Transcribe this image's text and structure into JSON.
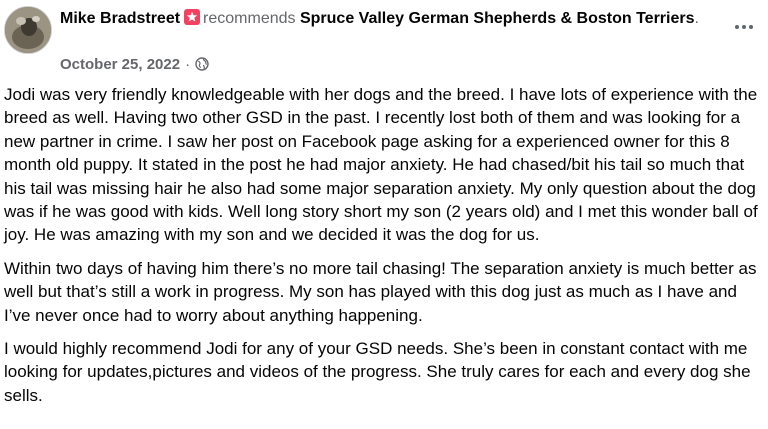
{
  "post": {
    "author": "Mike Bradstreet",
    "action": "recommends",
    "page_name": "Spruce Valley German Shepherds & Boston Terriers",
    "trailing_dot": ".",
    "date": "October 25, 2022",
    "separator": "·",
    "badge_icon": "recommend-star-icon",
    "privacy_icon": "globe-icon",
    "more_icon": "more-options-icon",
    "accent_color": "#f3425f",
    "paragraphs": [
      "Jodi was very friendly  knowledgeable with her dogs and the breed. I have lots of experience with the breed as well. Having two other GSD in the past. I recently lost both of them and was looking for a new partner in crime. I saw her post on Facebook page asking for a experienced owner for this 8 month old puppy. It stated in the post he had major anxiety. He had chased/bit his tail so much that his tail was missing hair he also had some major separation anxiety. My only question about the dog was if he was good with kids. Well long story short my son (2 years old) and I met this wonder ball of joy. He was amazing with my son and we decided it was the dog for us.",
      "Within two days of having him there’s no more tail chasing! The separation anxiety is much better as well but that’s still a work in progress. My son has played with this dog just as much as I have and I’ve never once had to worry about anything happening.",
      "I would highly recommend Jodi for any of your GSD needs. She’s been in constant contact with me looking for updates,pictures and videos of the progress. She truly cares for each and every dog she sells."
    ]
  }
}
